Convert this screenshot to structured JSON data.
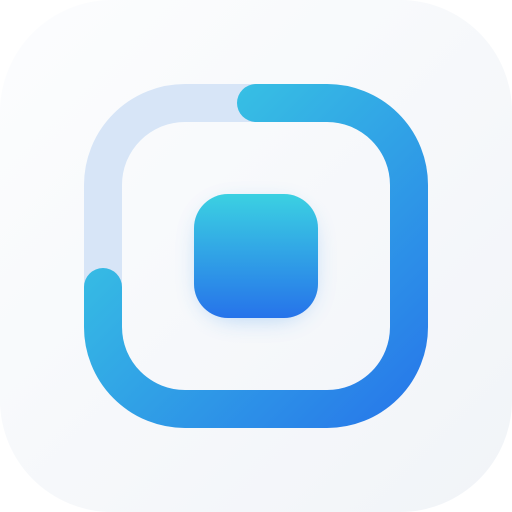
{
  "app_icon": {
    "icon_name": "square-stop-ring-icon",
    "colors": {
      "tile_background_top": "#FCFDFE",
      "tile_background_bottom": "#F1F4F8",
      "track_light": "#D7E5F7",
      "accent_start": "#3BD1E2",
      "accent_end": "#2673EA"
    }
  }
}
